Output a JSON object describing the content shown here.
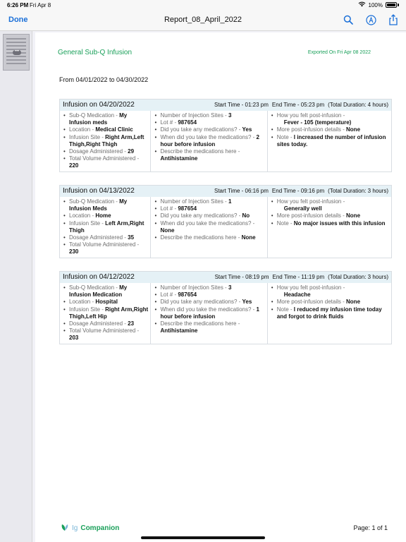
{
  "status_bar": {
    "time": "6:26 PM",
    "date": "Fri Apr 8",
    "battery": "100%"
  },
  "navbar": {
    "done_label": "Done",
    "title": "Report_08_April_2022"
  },
  "doc": {
    "title": "General Sub-Q Infusion",
    "exported": "Exported On Fri Apr 08 2022",
    "range": "From 04/01/2022 to 04/30/2022",
    "footer_ig": "Ig",
    "footer_companion": "Companion",
    "page_label": "Page: 1 of 1"
  },
  "infusions": [
    {
      "title": "Infusion on 04/20/2022",
      "start": "Start Time - 01:23 pm",
      "end": "End Time - 05:23 pm",
      "duration": "(Total Duration: 4 hours)",
      "c1": [
        {
          "label": "Sub-Q Medication - ",
          "value": "My Infusion meds"
        },
        {
          "label": "Location - ",
          "value": "Medical Clinic"
        },
        {
          "label": "Infusion Site - ",
          "value": "Right Arm,Left Thigh,Right Thigh"
        },
        {
          "label": "Dosage Administered - ",
          "value": "29"
        },
        {
          "label": "Total Volume Administered - ",
          "value": "220"
        }
      ],
      "c2": [
        {
          "label": "Number of Injection Sites - ",
          "value": "3"
        },
        {
          "label": "Lot # - ",
          "value": "987654"
        },
        {
          "label": "Did you take any medications? - ",
          "value": "Yes"
        },
        {
          "label": "When did you take the medications? - ",
          "value": "2 hour before infusion"
        },
        {
          "label": "Describe the medications here - ",
          "value": "Antihistamine"
        }
      ],
      "c3": [
        {
          "label": "How you felt post-infusion - ",
          "value": "Fever - 105 (temperature)",
          "indent": true
        },
        {
          "label": "More post-infusion details - ",
          "value": "None"
        },
        {
          "label": "Note - ",
          "value": "I increased the number of infusion sites today."
        }
      ]
    },
    {
      "title": "Infusion on 04/13/2022",
      "start": "Start Time - 06:16 pm",
      "end": "End Time - 09:16 pm",
      "duration": "(Total Duration: 3 hours)",
      "c1": [
        {
          "label": "Sub-Q Medication - ",
          "value": "My Infusion Meds"
        },
        {
          "label": "Location - ",
          "value": "Home"
        },
        {
          "label": "Infusion Site - ",
          "value": "Left Arm,Right Thigh"
        },
        {
          "label": "Dosage Administered - ",
          "value": "35"
        },
        {
          "label": "Total Volume Administered - ",
          "value": "230"
        }
      ],
      "c2": [
        {
          "label": "Number of Injection Sites - ",
          "value": "1"
        },
        {
          "label": "Lot # - ",
          "value": "987654"
        },
        {
          "label": "Did you take any medications? - ",
          "value": "No"
        },
        {
          "label": "When did you take the medications? - ",
          "value": "None"
        },
        {
          "label": "Describe the medications here - ",
          "value": "None"
        }
      ],
      "c3": [
        {
          "label": "How you felt post-infusion - ",
          "value": "Generally well",
          "indent": true
        },
        {
          "label": "More post-infusion details - ",
          "value": "None"
        },
        {
          "label": "Note - ",
          "value": "No major issues with this infusion"
        }
      ]
    },
    {
      "title": "Infusion on 04/12/2022",
      "start": "Start Time - 08:19 pm",
      "end": "End Time - 11:19 pm",
      "duration": "(Total Duration: 3 hours)",
      "c1": [
        {
          "label": "Sub-Q Medication - ",
          "value": "My Infusion Medication"
        },
        {
          "label": "Location - ",
          "value": "Hospital"
        },
        {
          "label": "Infusion Site - ",
          "value": "Right Arm,Right Thigh,Left Hip"
        },
        {
          "label": "Dosage Administered - ",
          "value": "23"
        },
        {
          "label": "Total Volume Administered - ",
          "value": "203"
        }
      ],
      "c2": [
        {
          "label": "Number of Injection Sites - ",
          "value": "3"
        },
        {
          "label": "Lot # - ",
          "value": "987654"
        },
        {
          "label": "Did you take any medications? - ",
          "value": "Yes"
        },
        {
          "label": "When did you take the medications? - ",
          "value": "1 hour before infusion"
        },
        {
          "label": "Describe the medications here - ",
          "value": "Antihistamine"
        }
      ],
      "c3": [
        {
          "label": "How you felt post-infusion - ",
          "value": "Headache",
          "indent": true
        },
        {
          "label": "More post-infusion details - ",
          "value": "None"
        },
        {
          "label": "Note - ",
          "value": "I reduced my infusion time today and forgot to drink fluids"
        }
      ]
    }
  ]
}
